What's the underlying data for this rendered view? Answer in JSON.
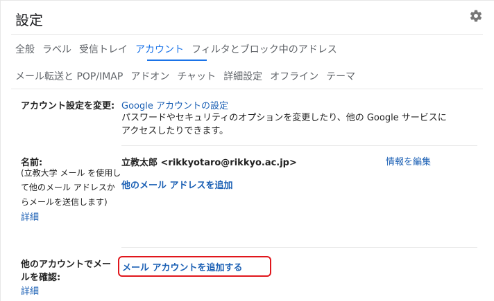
{
  "header": {
    "title": "設定",
    "settings_icon": "gear-icon"
  },
  "tabs": {
    "row1": [
      {
        "label": "全般"
      },
      {
        "label": "ラベル"
      },
      {
        "label": "受信トレイ"
      },
      {
        "label": "アカウント",
        "active": true
      },
      {
        "label": "フィルタとブロック中のアドレス"
      }
    ],
    "row2": [
      {
        "label": "メール転送と POP/IMAP"
      },
      {
        "label": "アドオン"
      },
      {
        "label": "チャット"
      },
      {
        "label": "詳細設定"
      },
      {
        "label": "オフライン"
      },
      {
        "label": "テーマ"
      }
    ]
  },
  "accounts": {
    "change_settings": {
      "label": "アカウント設定を変更:",
      "link": "Google アカウントの設定",
      "description_1": "パスワードやセキュリティのオプションを変更したり、他の Google サービスに",
      "description_2": "アクセスしたりできます。"
    },
    "name": {
      "label": "名前:",
      "note_1": "(立教大学 メール を使用し",
      "note_2": "て他のメール アドレスか",
      "note_3": "らメールを送信します)",
      "details": "詳細",
      "value": "立教太郎 <rikkyotaro@rikkyo.ac.jp>",
      "edit": "情報を編集",
      "add_address": "他のメール アドレスを追加"
    },
    "check_mail": {
      "label_1": "他のアカウントでメー",
      "label_2": "ルを確認:",
      "details": "詳細",
      "add_account": "メール アカウントを追加する"
    }
  },
  "colors": {
    "accent": "#1a73e8",
    "link": "#1a5fb4",
    "highlight": "#e0161c"
  }
}
